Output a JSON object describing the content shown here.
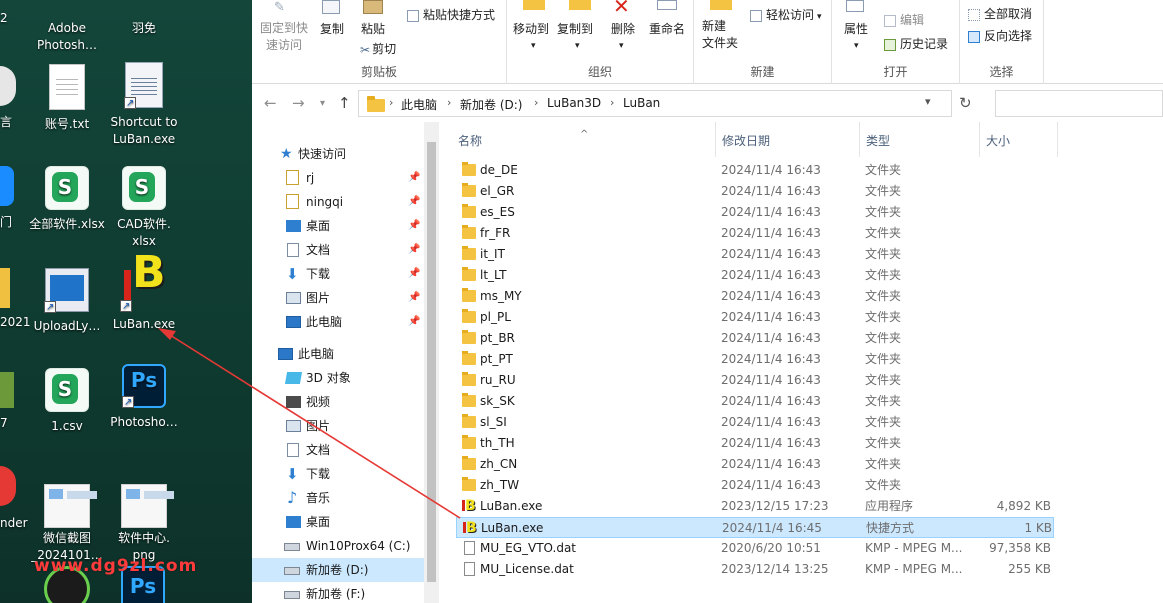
{
  "desktop": {
    "icons": [
      {
        "label": "Adobe\nPhotosh…"
      },
      {
        "label": "羽免"
      },
      {
        "label": "账号.txt"
      },
      {
        "label": "Shortcut to\nLuBan.exe"
      },
      {
        "label": "全部软件.xlsx"
      },
      {
        "label": "CAD软件.\nxlsx"
      },
      {
        "label": "UploadLy…"
      },
      {
        "label": "LuBan.exe"
      },
      {
        "label": "1.csv"
      },
      {
        "label": "Photosho…"
      },
      {
        "label": "微信截图\n_2024101…"
      },
      {
        "label": "软件中心.\npng"
      }
    ],
    "edge_labels": [
      "2",
      "言",
      "门",
      "2021",
      "7",
      "nder"
    ],
    "watermark": "www.dg9zl.com"
  },
  "ribbon": {
    "groups": [
      {
        "label": "剪贴板"
      },
      {
        "label": "组织"
      },
      {
        "label": "新建"
      },
      {
        "label": "打开"
      },
      {
        "label": "选择"
      }
    ],
    "pin_quick_access": "固定到快\n速访问",
    "copy": "复制",
    "paste": "粘贴",
    "paste_shortcut": "粘贴快捷方式",
    "cut": "剪切",
    "move_to": "移动到",
    "copy_to": "复制到",
    "delete": "删除",
    "rename": "重命名",
    "new_folder": "新建\n文件夹",
    "easy_access": "轻松访问",
    "properties": "属性",
    "edit": "编辑",
    "history": "历史记录",
    "select_none": "全部取消",
    "invert_selection": "反向选择"
  },
  "address": {
    "crumbs": [
      "此电脑",
      "新加卷 (D:)",
      "LuBan3D",
      "LuBan"
    ]
  },
  "navpane": {
    "quick_access": "快速访问",
    "quick_items": [
      "rj",
      "ningqi",
      "桌面",
      "文档",
      "下载",
      "图片",
      "此电脑"
    ],
    "this_pc": "此电脑",
    "pc_items": [
      "3D 对象",
      "视频",
      "图片",
      "文档",
      "下载",
      "音乐",
      "桌面",
      "Win10Prox64 (C:)",
      "新加卷 (D:)",
      "新加卷 (F:)"
    ]
  },
  "filelist": {
    "columns": [
      "名称",
      "修改日期",
      "类型",
      "大小"
    ],
    "rows": [
      {
        "name": "de_DE",
        "date": "2024/11/4 16:43",
        "type": "文件夹",
        "size": "",
        "kind": "folder"
      },
      {
        "name": "el_GR",
        "date": "2024/11/4 16:43",
        "type": "文件夹",
        "size": "",
        "kind": "folder"
      },
      {
        "name": "es_ES",
        "date": "2024/11/4 16:43",
        "type": "文件夹",
        "size": "",
        "kind": "folder"
      },
      {
        "name": "fr_FR",
        "date": "2024/11/4 16:43",
        "type": "文件夹",
        "size": "",
        "kind": "folder"
      },
      {
        "name": "it_IT",
        "date": "2024/11/4 16:43",
        "type": "文件夹",
        "size": "",
        "kind": "folder"
      },
      {
        "name": "lt_LT",
        "date": "2024/11/4 16:43",
        "type": "文件夹",
        "size": "",
        "kind": "folder"
      },
      {
        "name": "ms_MY",
        "date": "2024/11/4 16:43",
        "type": "文件夹",
        "size": "",
        "kind": "folder"
      },
      {
        "name": "pl_PL",
        "date": "2024/11/4 16:43",
        "type": "文件夹",
        "size": "",
        "kind": "folder"
      },
      {
        "name": "pt_BR",
        "date": "2024/11/4 16:43",
        "type": "文件夹",
        "size": "",
        "kind": "folder"
      },
      {
        "name": "pt_PT",
        "date": "2024/11/4 16:43",
        "type": "文件夹",
        "size": "",
        "kind": "folder"
      },
      {
        "name": "ru_RU",
        "date": "2024/11/4 16:43",
        "type": "文件夹",
        "size": "",
        "kind": "folder"
      },
      {
        "name": "sk_SK",
        "date": "2024/11/4 16:43",
        "type": "文件夹",
        "size": "",
        "kind": "folder"
      },
      {
        "name": "sl_SI",
        "date": "2024/11/4 16:43",
        "type": "文件夹",
        "size": "",
        "kind": "folder"
      },
      {
        "name": "th_TH",
        "date": "2024/11/4 16:43",
        "type": "文件夹",
        "size": "",
        "kind": "folder"
      },
      {
        "name": "zh_CN",
        "date": "2024/11/4 16:43",
        "type": "文件夹",
        "size": "",
        "kind": "folder"
      },
      {
        "name": "zh_TW",
        "date": "2024/11/4 16:43",
        "type": "文件夹",
        "size": "",
        "kind": "folder"
      },
      {
        "name": "LuBan.exe",
        "date": "2023/12/15 17:23",
        "type": "应用程序",
        "size": "4,892 KB",
        "kind": "exe"
      },
      {
        "name": "LuBan.exe",
        "date": "2024/11/4 16:45",
        "type": "快捷方式",
        "size": "1 KB",
        "kind": "shortcut"
      },
      {
        "name": "MU_EG_VTO.dat",
        "date": "2020/6/20 10:51",
        "type": "KMP - MPEG M...",
        "size": "97,358 KB",
        "kind": "file"
      },
      {
        "name": "MU_License.dat",
        "date": "2023/12/14 13:25",
        "type": "KMP - MPEG M...",
        "size": "255 KB",
        "kind": "file"
      }
    ],
    "selected_row": 17
  },
  "colors": {
    "desktop_bg": "#0f3a30",
    "selection": "#cce8ff",
    "arrow": "#e53935",
    "watermark": "#ff3b3b",
    "folder": "#f5c342"
  }
}
